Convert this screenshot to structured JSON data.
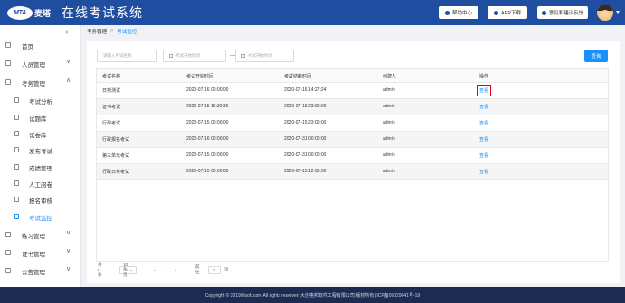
{
  "header": {
    "logo_badge": "MTA",
    "logo_text": "麦塔",
    "title": "在线考试系统",
    "buttons": [
      {
        "label": "帮助中心",
        "icon": "help-icon"
      },
      {
        "label": "APP下载",
        "icon": "download-icon"
      },
      {
        "label": "意见和建议反馈",
        "icon": "feedback-icon"
      }
    ]
  },
  "sidebar": {
    "collapse_icon": "‹",
    "menus": [
      {
        "label": "首页",
        "icon": "home-icon",
        "chevron": ""
      },
      {
        "label": "人员管理",
        "icon": "user-icon",
        "chevron": "∨"
      },
      {
        "label": "考务管理",
        "icon": "exam-icon",
        "chevron": "∧"
      }
    ],
    "sub_items": [
      {
        "label": "考试分析",
        "icon": "analysis-icon"
      },
      {
        "label": "试题库",
        "icon": "question-bank-icon"
      },
      {
        "label": "试卷库",
        "icon": "paper-bank-icon"
      },
      {
        "label": "发布考试",
        "icon": "publish-icon"
      },
      {
        "label": "成绩管理",
        "icon": "score-icon"
      },
      {
        "label": "人工阅卷",
        "icon": "grading-icon"
      },
      {
        "label": "报名审核",
        "icon": "review-icon"
      },
      {
        "label": "考试监控",
        "icon": "monitor-icon"
      }
    ],
    "bottom_menus": [
      {
        "label": "练习管理",
        "icon": "practice-icon",
        "chevron": "∨"
      },
      {
        "label": "证书管理",
        "icon": "certificate-icon",
        "chevron": "∨"
      },
      {
        "label": "公告管理",
        "icon": "notice-icon",
        "chevron": "∨"
      }
    ],
    "active_sub": "考试监控"
  },
  "breadcrumb": {
    "parent": "考务管理",
    "separator": ">",
    "current": "考试监控"
  },
  "filters": {
    "name_placeholder": "请输入考试名称",
    "start_placeholder": "考试开始时间",
    "dash": "—",
    "end_placeholder": "考试开始时间",
    "query_label": "查询"
  },
  "table": {
    "columns": [
      "考试名称",
      "考试开始时间",
      "考试结束时间",
      "创建人",
      "操作"
    ],
    "rows": [
      [
        "日常测试",
        "2020-07-16 00:00:00",
        "2020-07-16 14:27:24",
        "admin",
        "查看"
      ],
      [
        "证书考试",
        "2020-07-15 16:30:36",
        "2020-07-15 23:00:00",
        "admin",
        "查看"
      ],
      [
        "行政考试",
        "2020-07-15 00:00:00",
        "2020-07-15 23:00:00",
        "admin",
        "查看"
      ],
      [
        "行政报名考试",
        "2020-07-16 00:00:00",
        "2020-07-31 00:00:00",
        "admin",
        "查看"
      ],
      [
        "第三单元考试",
        "2020-07-15 00:00:00",
        "2020-07-31 00:00:00",
        "admin",
        "查看"
      ],
      [
        "行政日常考试",
        "2020-07-15 00:00:00",
        "2020-07-15 12:00:00",
        "admin",
        "查看"
      ]
    ]
  },
  "pagination": {
    "total": "共 6 条",
    "page_size": "10条/页",
    "prev": "‹",
    "current_page": "1",
    "next": "›",
    "goto_label": "前往",
    "goto_value": "1",
    "page_suffix": "页"
  },
  "footer": {
    "text": "Copyright © 2019 illsoft.com All rights reserved 大连格邦软件工程有限公司 版权所有 (ICP备09029041号-19"
  },
  "colors": {
    "header_bg": "#1f4ea0",
    "accent": "#1890ff",
    "footer_bg": "#1d2a52",
    "highlight": "#e60012"
  }
}
